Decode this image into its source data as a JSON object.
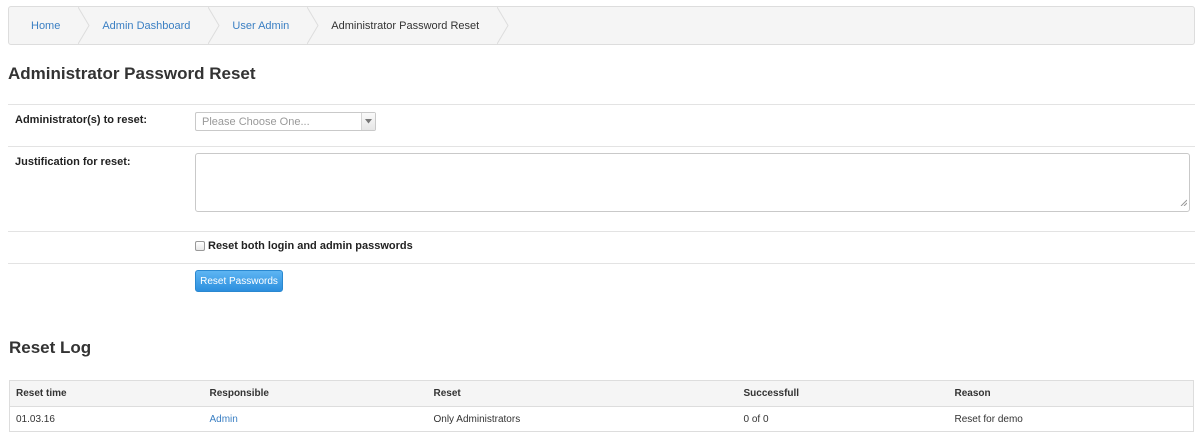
{
  "breadcrumb": {
    "items": [
      {
        "label": "Home",
        "link": true
      },
      {
        "label": "Admin Dashboard",
        "link": true
      },
      {
        "label": "User Admin",
        "link": true
      },
      {
        "label": "Administrator Password Reset",
        "link": false
      }
    ]
  },
  "page_title": "Administrator Password Reset",
  "form": {
    "administrators_label": "Administrator(s) to reset:",
    "administrators_placeholder": "Please Choose One...",
    "justification_label": "Justification for reset:",
    "justification_value": "",
    "reset_both_label": "Reset both login and admin passwords",
    "reset_both_checked": false,
    "submit_label": "Reset Passwords",
    "submit_color": "#2c8fdf"
  },
  "reset_log": {
    "title": "Reset Log",
    "columns": [
      "Reset time",
      "Responsible",
      "Reset",
      "Successfull",
      "Reason"
    ],
    "rows": [
      {
        "reset_time": "01.03.16",
        "responsible": "Admin",
        "reset": "Only Administrators",
        "successful": "0 of 0",
        "reason": "Reset for demo"
      }
    ]
  },
  "colors": {
    "link": "#3a7fc3",
    "breadcrumb_bg": "#f5f5f5"
  }
}
